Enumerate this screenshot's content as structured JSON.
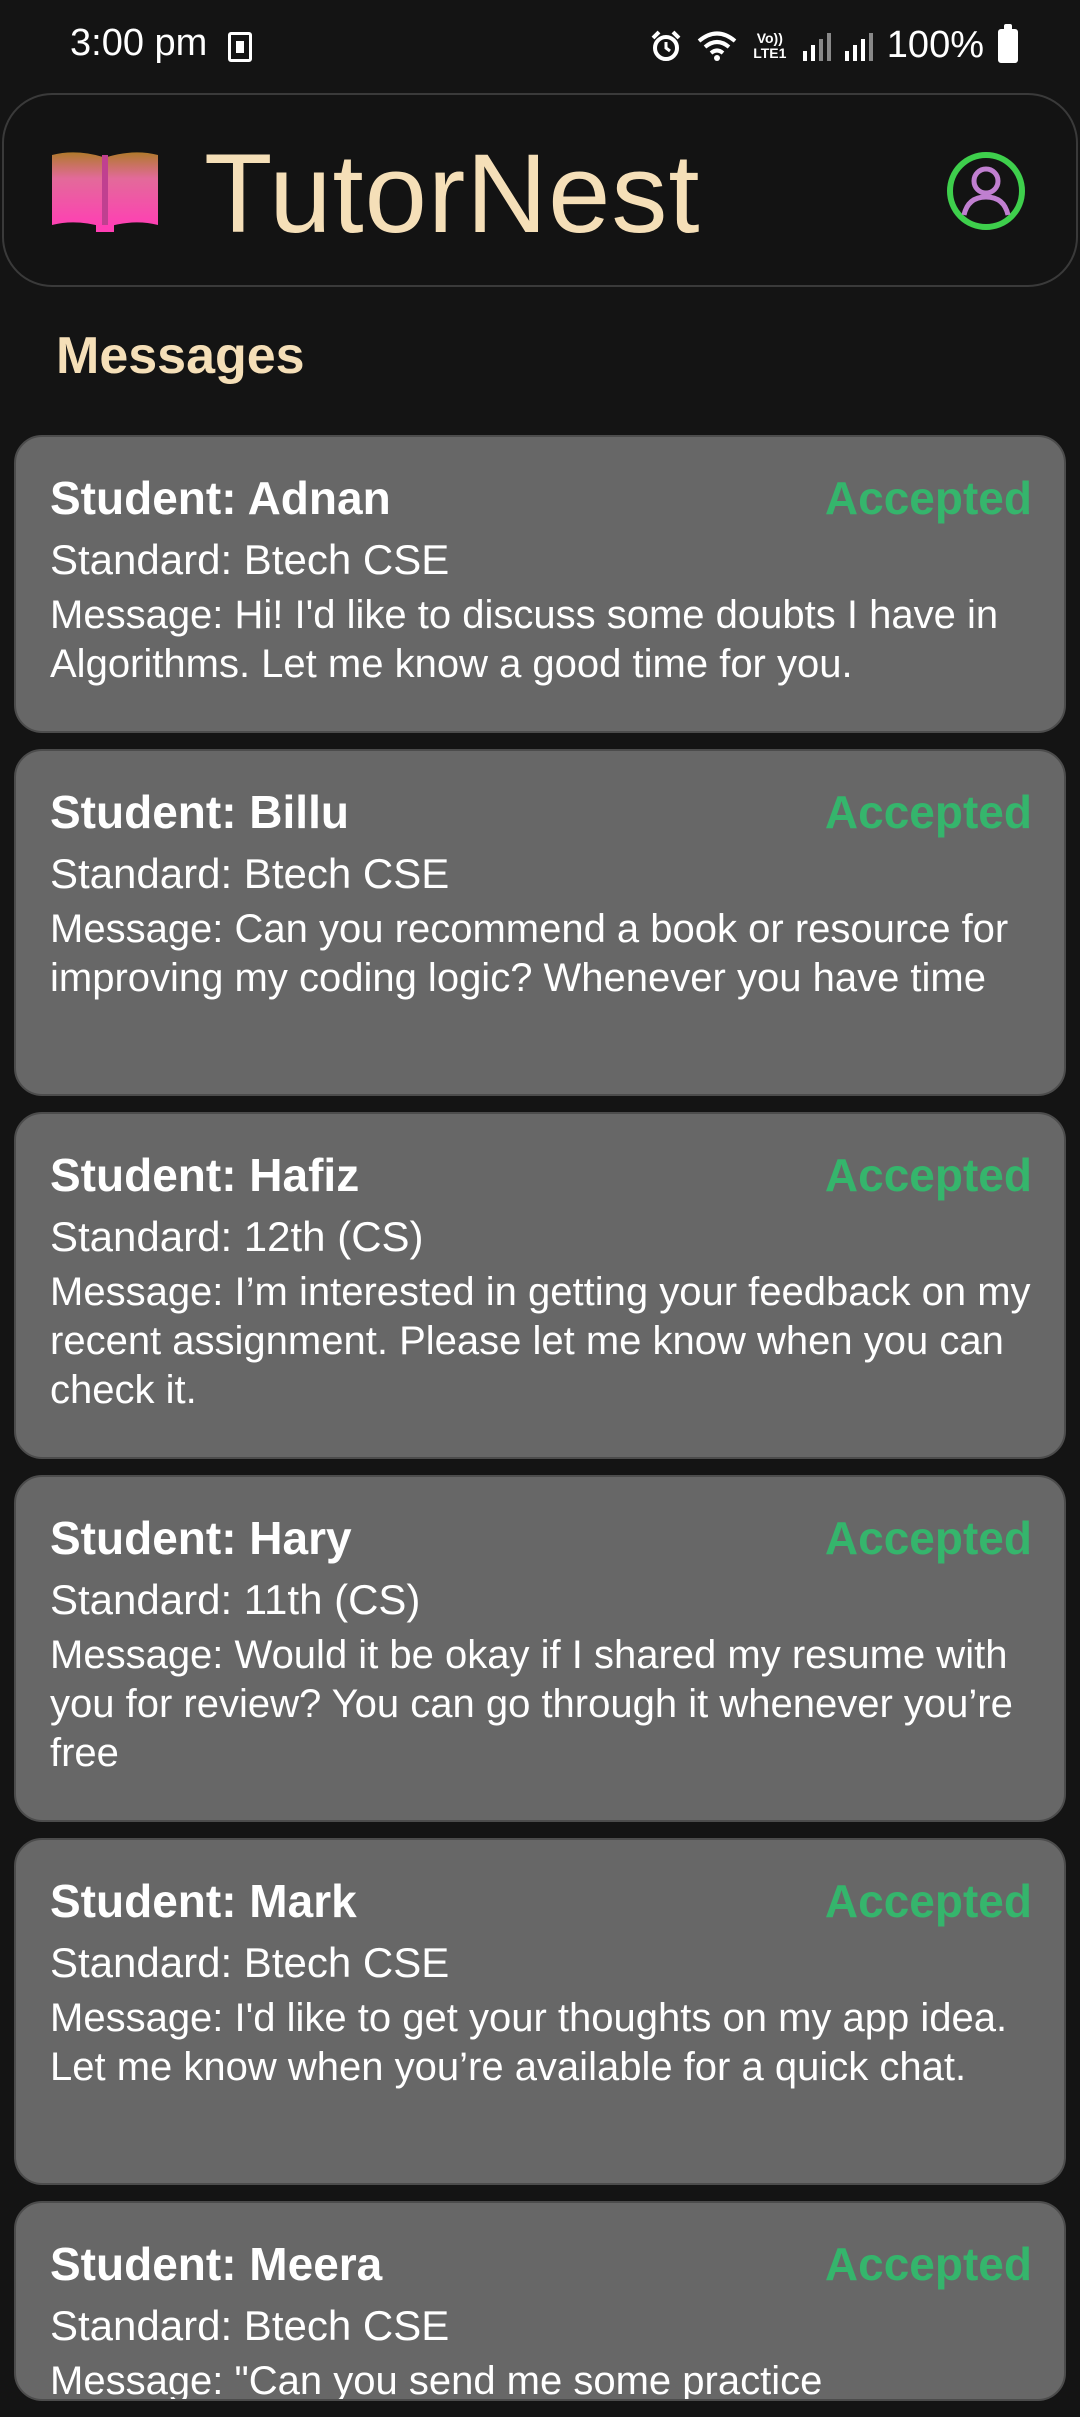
{
  "status_bar": {
    "time": "3:00 pm",
    "network_label": "Vo)) LTE1",
    "battery": "100%"
  },
  "header": {
    "app_title": "TutorNest",
    "logo_icon": "book-icon",
    "profile_icon": "user-circle-icon",
    "colors": {
      "title": "#f5dfb8",
      "profile_ring": "#3ecf4c",
      "profile_person": "#c07fd0"
    }
  },
  "section_title": "Messages",
  "messages": [
    {
      "student": "Student: Adnan",
      "status": "Accepted",
      "standard": "Standard: Btech CSE",
      "message": "Message: Hi! I'd like to discuss some doubts I have in Algorithms. Let me know a good time for you."
    },
    {
      "student": "Student: Billu",
      "status": "Accepted",
      "standard": "Standard: Btech CSE",
      "message": "Message: Can you recommend a book or resource for improving my coding logic? Whenever you have time"
    },
    {
      "student": "Student: Hafiz",
      "status": "Accepted",
      "standard": "Standard: 12th (CS)",
      "message": "Message: I’m interested in getting your feedback on my recent assignment. Please let me know when you can check it."
    },
    {
      "student": "Student: Hary",
      "status": "Accepted",
      "standard": "Standard: 11th (CS)",
      "message": "Message: Would it be okay if I shared my resume with you for review? You can go through it whenever you’re free"
    },
    {
      "student": "Student: Mark",
      "status": "Accepted",
      "standard": "Standard: Btech CSE",
      "message": "Message: I'd like to get your thoughts on my app idea. Let me know when you’re available for a quick chat."
    },
    {
      "student": "Student: Meera",
      "status": "Accepted",
      "standard": "Standard: Btech CSE",
      "message": "Message: \"Can you send me some practice"
    }
  ],
  "colors": {
    "background": "#141414",
    "card": "#676767",
    "accepted": "#35b56c"
  }
}
